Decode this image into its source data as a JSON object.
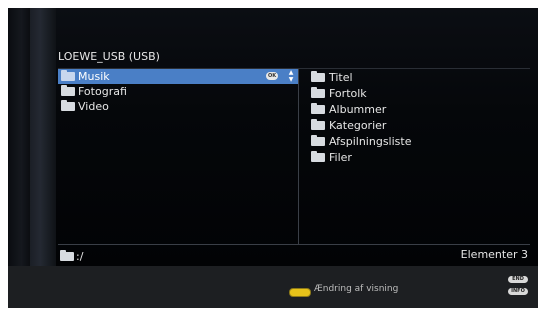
{
  "browser": {
    "title": "LOEWE_USB (USB)",
    "left_items": [
      {
        "label": "Musik",
        "selected": true
      },
      {
        "label": "Fotografi",
        "selected": false
      },
      {
        "label": "Video",
        "selected": false
      }
    ],
    "ok_label": "OK",
    "right_items": [
      "Titel",
      "Fortolk",
      "Albummer",
      "Kategorier",
      "Afspilningsliste",
      "Filer"
    ],
    "path": ":/",
    "count_text": "Elementer 3"
  },
  "footer": {
    "yellow_label": "Ændring af visning",
    "end_label": "END",
    "info_label": "INFO"
  },
  "colors": {
    "selection": "#4a7fc6",
    "yellow_button": "#e6c21a",
    "footer_bg": "#1d1f22"
  },
  "icons": {
    "folder": "folder-icon",
    "ok": "ok-icon",
    "updown": "up-down-arrows-icon",
    "yellow": "yellow-button-icon"
  }
}
